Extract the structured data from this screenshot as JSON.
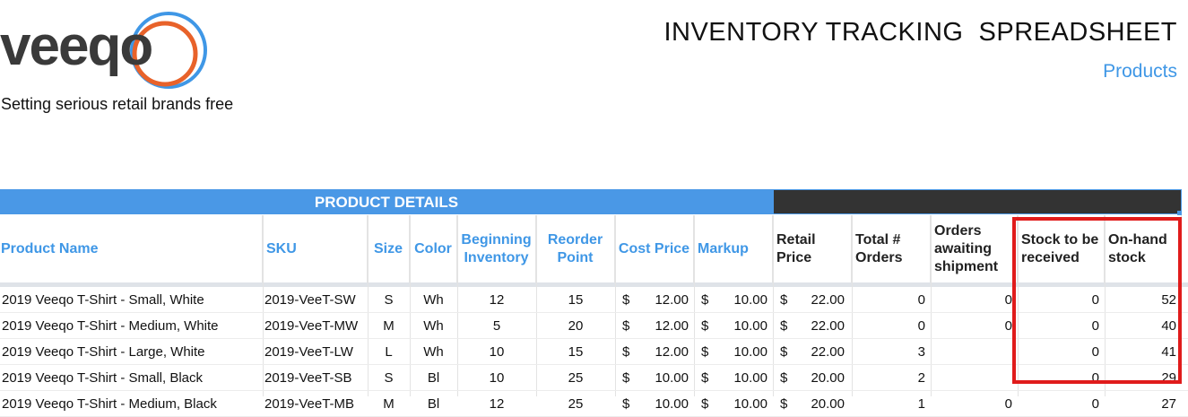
{
  "brand": {
    "logo_text": "veeqo",
    "tagline": "Setting serious retail brands free",
    "colors": {
      "accent": "#3f97e6",
      "logo_text": "#3a3a3a",
      "ring_orange": "#e8622a",
      "ring_blue": "#3f97e6",
      "highlight": "#e01b1b"
    }
  },
  "document": {
    "title": "INVENTORY TRACKING  SPREADSHEET",
    "subtitle": "Products"
  },
  "table": {
    "section_label": "PRODUCT DETAILS",
    "headers": {
      "product_name": "Product Name",
      "sku": "SKU",
      "size": "Size",
      "color": "Color",
      "beginning_inventory": "Beginning Inventory",
      "reorder_point": "Reorder Point",
      "cost_price": "Cost Price",
      "markup": "Markup",
      "retail_price": "Retail Price",
      "total_orders": "Total # Orders",
      "orders_awaiting": "Orders awaiting shipment",
      "stock_to_receive": "Stock to be received",
      "on_hand": "On-hand stock"
    },
    "currency_symbol": "$",
    "rows": [
      {
        "name": "2019 Veeqo T-Shirt - Small, White",
        "sku": "2019-VeeT-SW",
        "size": "S",
        "color": "Wh",
        "beginning": "12",
        "reorder": "15",
        "cost": "12.00",
        "markup": "10.00",
        "retail": "22.00",
        "total_orders": "0",
        "awaiting": "0",
        "to_receive": "0",
        "on_hand": "52"
      },
      {
        "name": "2019 Veeqo T-Shirt - Medium, White",
        "sku": "2019-VeeT-MW",
        "size": "M",
        "color": "Wh",
        "beginning": "5",
        "reorder": "20",
        "cost": "12.00",
        "markup": "10.00",
        "retail": "22.00",
        "total_orders": "0",
        "awaiting": "0",
        "to_receive": "0",
        "on_hand": "40"
      },
      {
        "name": "2019 Veeqo T-Shirt - Large, White",
        "sku": "2019-VeeT-LW",
        "size": "L",
        "color": "Wh",
        "beginning": "10",
        "reorder": "15",
        "cost": "12.00",
        "markup": "10.00",
        "retail": "22.00",
        "total_orders": "3",
        "awaiting": "",
        "to_receive": "0",
        "on_hand": "41"
      },
      {
        "name": "2019 Veeqo T-Shirt - Small, Black",
        "sku": "2019-VeeT-SB",
        "size": "S",
        "color": "Bl",
        "beginning": "10",
        "reorder": "25",
        "cost": "10.00",
        "markup": "10.00",
        "retail": "20.00",
        "total_orders": "2",
        "awaiting": "",
        "to_receive": "0",
        "on_hand": "29"
      },
      {
        "name": "2019 Veeqo T-Shirt - Medium, Black",
        "sku": "2019-VeeT-MB",
        "size": "M",
        "color": "Bl",
        "beginning": "12",
        "reorder": "25",
        "cost": "10.00",
        "markup": "10.00",
        "retail": "20.00",
        "total_orders": "1",
        "awaiting": "0",
        "to_receive": "0",
        "on_hand": "27"
      }
    ]
  }
}
